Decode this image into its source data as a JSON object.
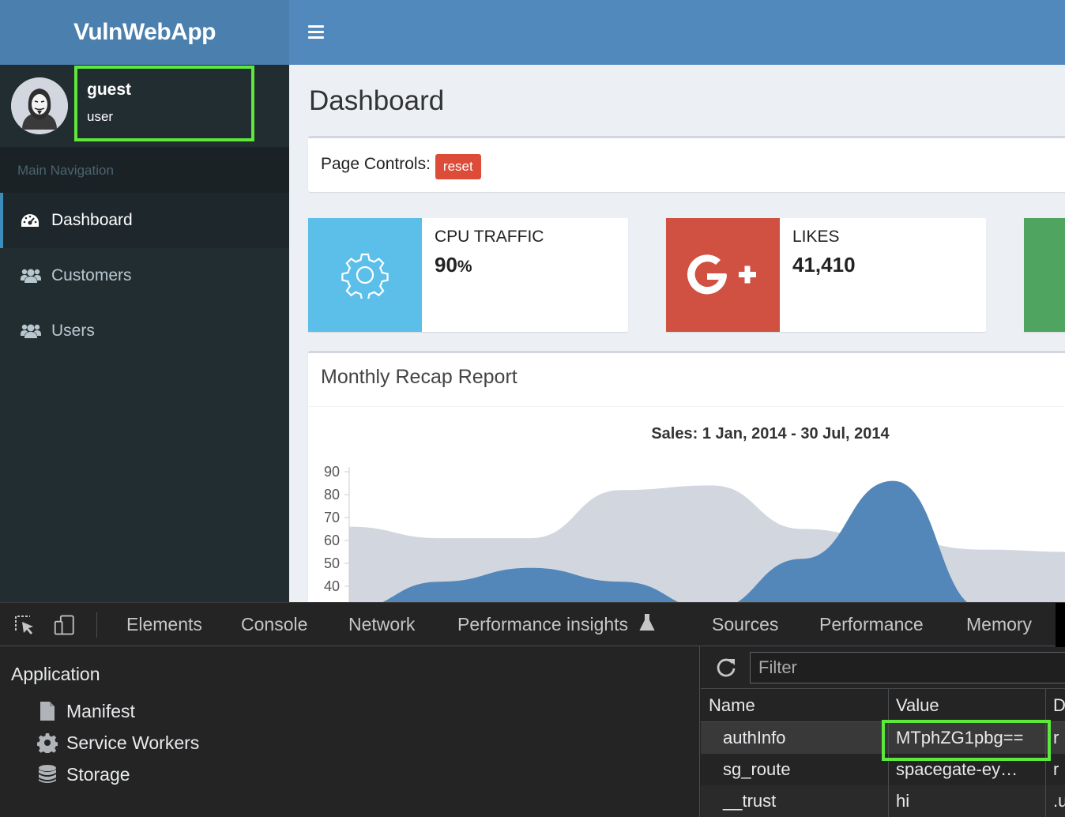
{
  "app": {
    "title": "VulnWebApp"
  },
  "user": {
    "name": "guest",
    "role": "user"
  },
  "sidebar": {
    "header": "Main Navigation",
    "items": [
      {
        "label": "Dashboard",
        "icon": "dashboard-icon",
        "active": true
      },
      {
        "label": "Customers",
        "icon": "users-icon"
      },
      {
        "label": "Users",
        "icon": "users-icon"
      }
    ]
  },
  "page": {
    "title": "Dashboard"
  },
  "controls": {
    "label": "Page Controls:",
    "reset_label": "reset"
  },
  "info_boxes": [
    {
      "label": "CPU TRAFFIC",
      "value": "90",
      "unit": "%",
      "icon": "gear-icon",
      "color": "#5bbfea"
    },
    {
      "label": "LIKES",
      "value": "41,410",
      "icon": "google-plus-icon",
      "color": "#d05141"
    },
    {
      "label": "",
      "value": "",
      "icon": "",
      "color": "#4fa55f"
    }
  ],
  "report": {
    "title": "Monthly Recap Report"
  },
  "chart_data": {
    "type": "area",
    "title": "Sales: 1 Jan, 2014 - 30 Jul, 2014",
    "yticks": [
      90,
      80,
      70,
      60,
      50,
      40
    ],
    "series": [
      {
        "color": "#d2d6de",
        "points": [
          [
            0,
            66
          ],
          [
            1,
            61
          ],
          [
            2,
            61
          ],
          [
            3,
            82
          ],
          [
            4,
            84
          ],
          [
            5,
            65
          ],
          [
            6,
            60
          ],
          [
            7,
            56
          ],
          [
            8,
            55
          ]
        ]
      },
      {
        "color": "#5387b9",
        "points": [
          [
            0,
            30
          ],
          [
            1,
            42
          ],
          [
            2,
            48
          ],
          [
            3,
            42
          ],
          [
            4,
            30
          ],
          [
            5,
            52
          ],
          [
            6,
            86
          ],
          [
            7,
            30
          ],
          [
            8,
            30
          ]
        ]
      }
    ],
    "ylim": [
      35,
      95
    ]
  },
  "devtools": {
    "tabs": [
      "Elements",
      "Console",
      "Network",
      "Performance insights",
      "Sources",
      "Performance",
      "Memory"
    ],
    "sidebar": {
      "header": "Application",
      "items": [
        {
          "label": "Manifest",
          "icon": "file-icon"
        },
        {
          "label": "Service Workers",
          "icon": "gear-icon"
        },
        {
          "label": "Storage",
          "icon": "database-icon"
        }
      ]
    },
    "filter_placeholder": "Filter",
    "cookies": {
      "columns": [
        "Name",
        "Value",
        "D"
      ],
      "rows": [
        {
          "name": "authInfo",
          "value": "MTphZG1pbg==",
          "d": "r"
        },
        {
          "name": "sg_route",
          "value": "spacegate-ey…",
          "d": "r"
        },
        {
          "name": "__trust",
          "value": "hi",
          "d": ".u"
        }
      ]
    }
  }
}
